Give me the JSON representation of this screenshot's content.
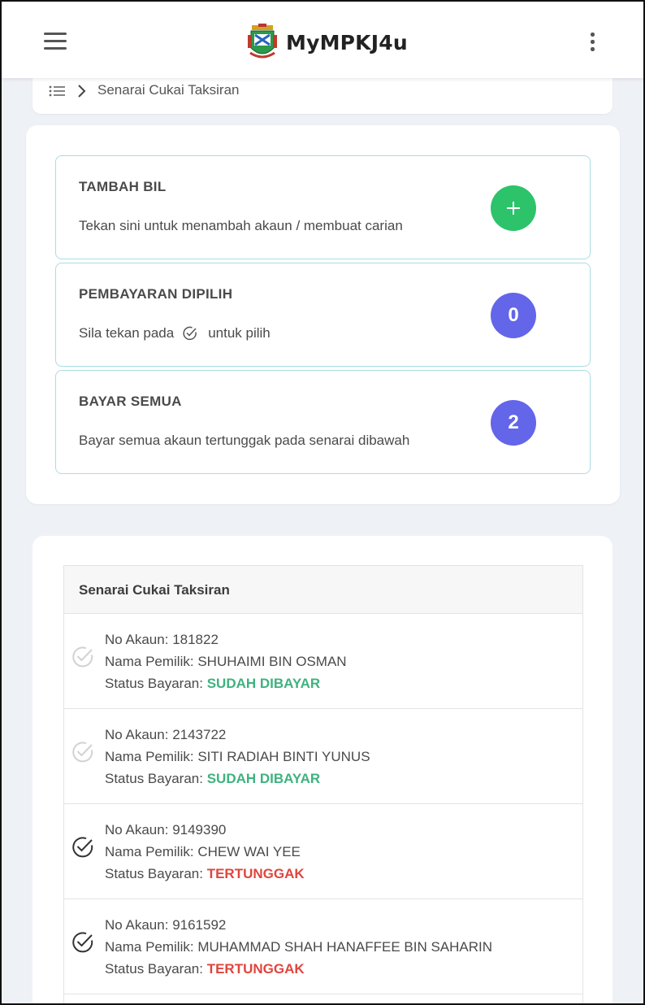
{
  "header": {
    "title": "MyMPKJ4u"
  },
  "breadcrumb": {
    "current": "Senarai Cukai Taksiran"
  },
  "actions": [
    {
      "title": "TAMBAH BIL",
      "desc": "Tekan sini untuk menambah akaun / membuat carian",
      "badge_icon": "plus-icon"
    },
    {
      "title": "PEMBAYARAN DIPILIH",
      "desc_before": "Sila tekan pada",
      "desc_after": "untuk pilih",
      "count": "0"
    },
    {
      "title": "BAYAR SEMUA",
      "desc": "Bayar semua akaun tertunggak pada senarai dibawah",
      "count": "2"
    }
  ],
  "list": {
    "title": "Senarai Cukai Taksiran",
    "labels": {
      "account": "No Akaun:",
      "owner": "Nama Pemilik:",
      "status": "Status Bayaran:"
    },
    "rows": [
      {
        "account": "181822",
        "owner": "SHUHAIMI BIN OSMAN",
        "status": "SUDAH DIBAYAR"
      },
      {
        "account": "2143722",
        "owner": "SITI RADIAH BINTI YUNUS",
        "status": "SUDAH DIBAYAR"
      },
      {
        "account": "9149390",
        "owner": "CHEW WAI YEE",
        "status": "TERTUNGGAK"
      },
      {
        "account": "9161592",
        "owner": "MUHAMMAD SHAH HANAFFEE BIN SAHARIN",
        "status": "TERTUNGGAK"
      }
    ]
  },
  "colors": {
    "paid": "#3fb27f",
    "due": "#e0453e",
    "add_button": "#2cc36b",
    "count_badge": "#6366e8",
    "box_border": "#a9dde3"
  }
}
